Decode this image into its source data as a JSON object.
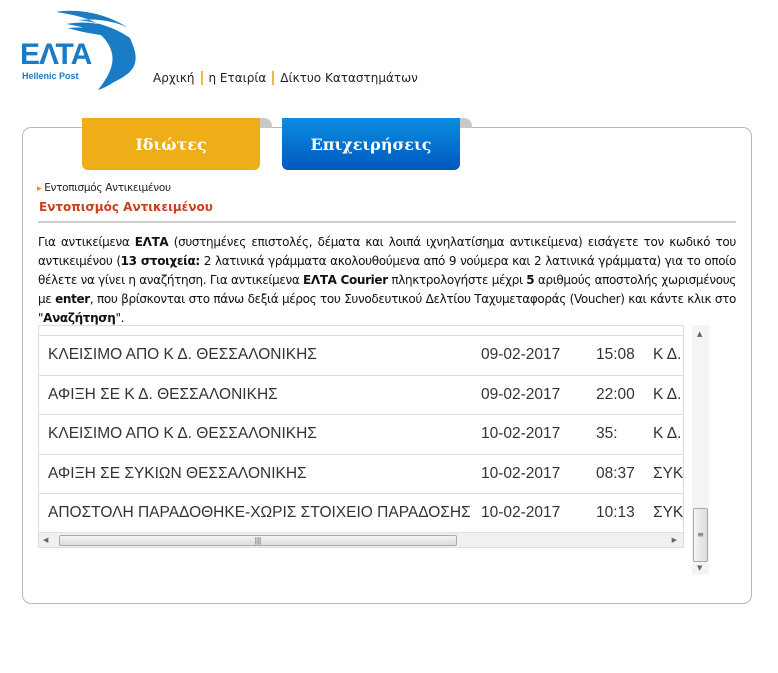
{
  "logo": {
    "text": "ΕΛΤΑ",
    "subtitle": "Hellenic Post",
    "brand_color": "#1a7cc4"
  },
  "topnav": [
    {
      "label": "Αρχική"
    },
    {
      "label": "η Εταιρία"
    },
    {
      "label": "Δίκτυο Καταστημάτων"
    }
  ],
  "tabs": [
    {
      "label": "Ιδιώτες",
      "color": "#efae17"
    },
    {
      "label": "Επιχειρήσεις",
      "color": "#0a74d4"
    }
  ],
  "breadcrumb": "Εντοπισμός Αντικειμένου",
  "heading": "Εντοπισμός Αντικειμένου",
  "instructions": [
    {
      "text": "Για αντικείμενα ",
      "bold": false
    },
    {
      "text": "ΕΛΤΑ",
      "bold": true
    },
    {
      "text": " (συστημένες επιστολές, δέματα και λοιπά ιχνηλατίσημα αντικείμενα) εισάγετε τον κωδικό του αντικειμένου (",
      "bold": false
    },
    {
      "text": "13 στοιχεία:",
      "bold": true
    },
    {
      "text": " 2 λατινικά γράμματα ακολουθούμενα από 9 νούμερα και 2 λατινικά γράμματα) για το οποίο θέλετε να γίνει η αναζήτηση. Για αντικείμενα ",
      "bold": false
    },
    {
      "text": "ΕΛΤΑ Courier",
      "bold": true
    },
    {
      "text": " πληκτρολογήστε μέχρι ",
      "bold": false
    },
    {
      "text": "5",
      "bold": true
    },
    {
      "text": " αριθμούς αποστολής χωρισμένους με ",
      "bold": false
    },
    {
      "text": "enter",
      "bold": true
    },
    {
      "text": ", που βρίσκονται στο πάνω δεξιά μέρος του Συνοδευτικού Δελτίου Ταχυμεταφοράς (Voucher) και κάντε κλικ στο \"",
      "bold": false
    },
    {
      "text": "Αναζήτηση",
      "bold": true
    },
    {
      "text": "\".",
      "bold": false
    }
  ],
  "tracking_rows": [
    {
      "status": "ΚΛΕΙΣΙΜΟ ΑΠΟ Κ Δ. ΘΕΣΣΑΛΟΝΙΚΗΣ",
      "date": "09-02-2017",
      "time": "15:08",
      "location": "Κ Δ."
    },
    {
      "status": "ΑΦΙΞΗ ΣΕ Κ Δ. ΘΕΣΣΑΛΟΝΙΚΗΣ",
      "date": "09-02-2017",
      "time": "22:00",
      "location": "Κ Δ."
    },
    {
      "status": "ΚΛΕΙΣΙΜΟ ΑΠΟ Κ Δ. ΘΕΣΣΑΛΟΝΙΚΗΣ",
      "date": "10-02-2017",
      "time": "35:",
      "location": "Κ Δ."
    },
    {
      "status": "ΑΦΙΞΗ ΣΕ ΣΥΚΙΩΝ ΘΕΣΣΑΛΟΝΙΚΗΣ",
      "date": "10-02-2017",
      "time": "08:37",
      "location": "ΣΥΚ"
    },
    {
      "status": "ΑΠΟΣΤΟΛΗ ΠΑΡΑΔΟΘΗΚΕ-ΧΩΡΙΣ ΣΤΟΙΧΕΙΟ ΠΑΡΑΔΟΣΗΣ",
      "date": "10-02-2017",
      "time": "10:13",
      "location": "ΣΥΚ"
    }
  ]
}
